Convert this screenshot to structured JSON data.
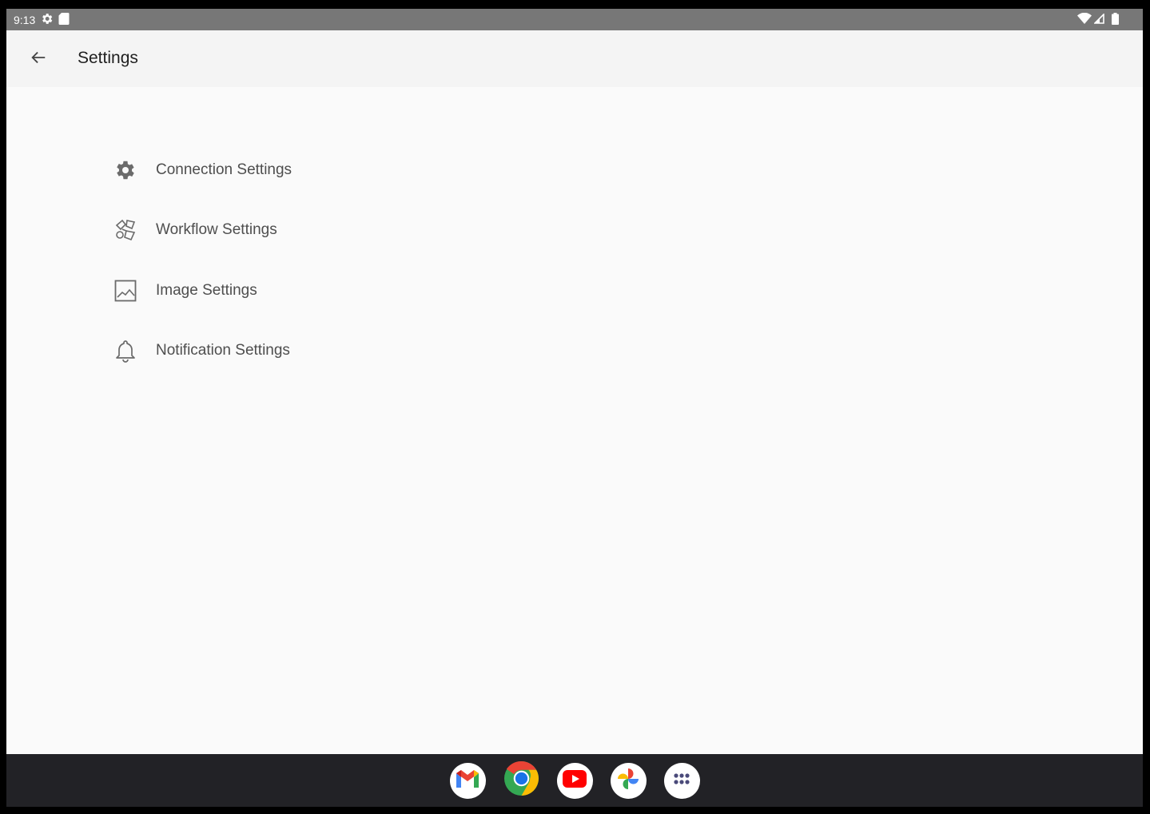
{
  "status_bar": {
    "time": "9:13",
    "left_icons": [
      "gear-icon",
      "sd-card-icon"
    ],
    "right_icons": [
      "wifi-icon",
      "cell-signal-icon",
      "battery-icon"
    ]
  },
  "app_bar": {
    "back_icon": "arrow-back-icon",
    "title": "Settings"
  },
  "menu": {
    "items": [
      {
        "label": "Connection Settings",
        "icon": "gear-icon"
      },
      {
        "label": "Workflow Settings",
        "icon": "workflow-icon"
      },
      {
        "label": "Image Settings",
        "icon": "image-icon"
      },
      {
        "label": "Notification Settings",
        "icon": "bell-icon"
      }
    ]
  },
  "taskbar": {
    "apps": [
      {
        "name": "Gmail",
        "icon": "gmail-icon"
      },
      {
        "name": "Chrome",
        "icon": "chrome-icon"
      },
      {
        "name": "YouTube",
        "icon": "youtube-icon"
      },
      {
        "name": "Photos",
        "icon": "photos-icon"
      },
      {
        "name": "App drawer",
        "icon": "app-drawer-icon"
      }
    ]
  },
  "colors": {
    "status_bar_bg": "#777777",
    "app_bar_bg": "#f4f4f4",
    "page_bg": "#fafafa",
    "taskbar_bg": "#222226",
    "icon_gray": "#6b6b6b",
    "label_gray": "#4e4e4e"
  }
}
